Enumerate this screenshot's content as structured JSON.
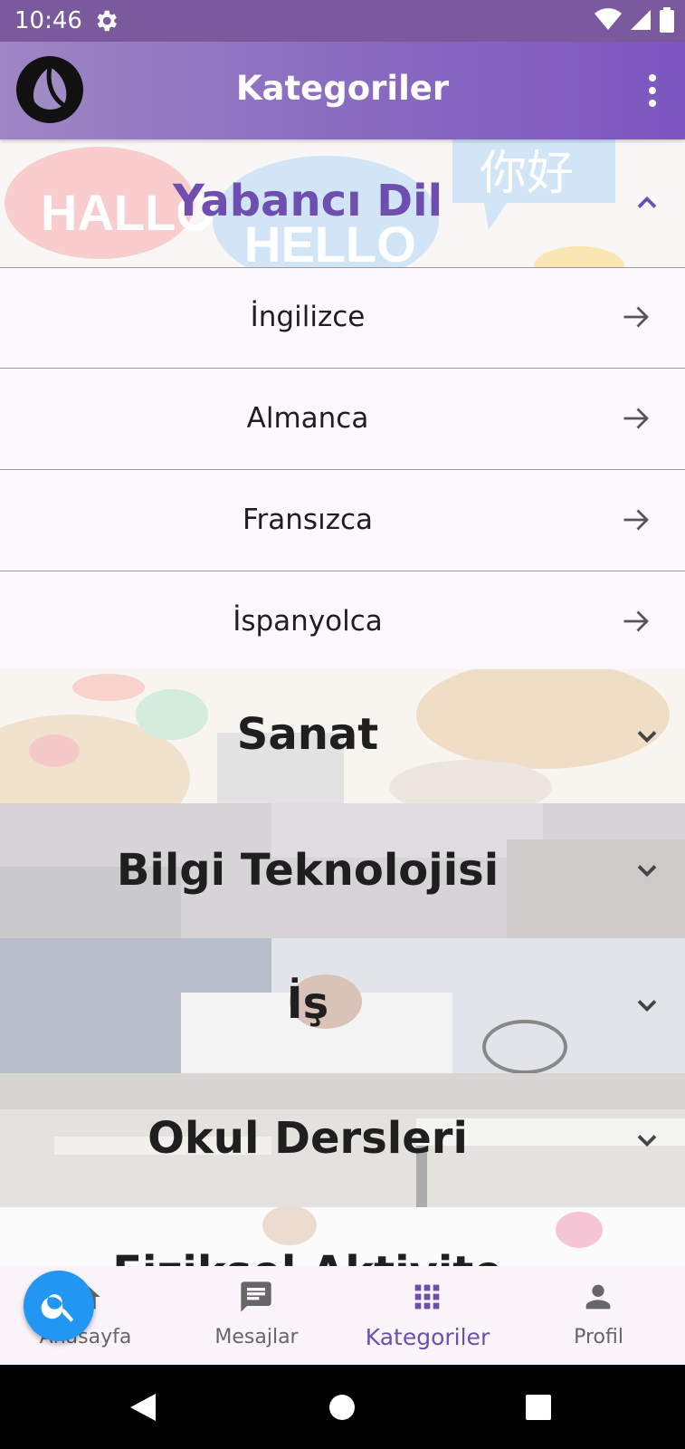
{
  "status_bar": {
    "time": "10:46"
  },
  "app_bar": {
    "title": "Kategoriler"
  },
  "categories": [
    {
      "title": "Yabancı Dil",
      "expanded": true,
      "items": [
        "İngilizce",
        "Almanca",
        "Fransızca",
        "İspanyolca"
      ],
      "bg_words": [
        "HALLO",
        "HELLO",
        "你好"
      ]
    },
    {
      "title": "Sanat",
      "expanded": false
    },
    {
      "title": "Bilgi Teknolojisi",
      "expanded": false
    },
    {
      "title": "İş",
      "expanded": false
    },
    {
      "title": "Okul Dersleri",
      "expanded": false
    },
    {
      "title": "Fiziksel Aktivite",
      "expanded": false
    }
  ],
  "bottom_nav": [
    {
      "label": "Anasayfa",
      "icon": "home-icon"
    },
    {
      "label": "Mesajlar",
      "icon": "chat-icon"
    },
    {
      "label": "Kategoriler",
      "icon": "grid-icon",
      "active": true
    },
    {
      "label": "Profil",
      "icon": "person-icon"
    }
  ],
  "colors": {
    "accent": "#6e4fb0",
    "fab": "#2196f3",
    "app_bar": "#8a6cc0"
  }
}
